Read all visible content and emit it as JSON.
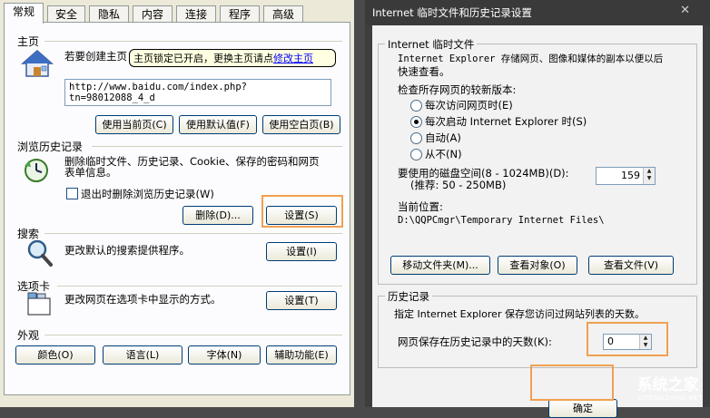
{
  "tabs": [
    "常规",
    "安全",
    "隐私",
    "内容",
    "连接",
    "程序",
    "高级"
  ],
  "home": {
    "title": "主页",
    "desc": "若要创建主页",
    "url": "http://www.baidu.com/index.php?tn=98012088_4_d",
    "tooltip_text": "主页锁定已开启，更换主页请点",
    "tooltip_link": "修改主页",
    "btn_current": "使用当前页(C)",
    "btn_default": "使用默认值(F)",
    "btn_blank": "使用空白页(B)"
  },
  "history": {
    "title": "浏览历史记录",
    "desc_line1": "删除临时文件、历史记录、Cookie、保存的密码和网页",
    "desc_line2": "表单信息。",
    "checkbox_label": "退出时删除浏览历史记录(W)",
    "btn_delete": "删除(D)...",
    "btn_settings": "设置(S)"
  },
  "search": {
    "title": "搜索",
    "desc": "更改默认的搜索提供程序。",
    "btn_settings": "设置(I)"
  },
  "tabs_section": {
    "title": "选项卡",
    "desc": "更改网页在选项卡中显示的方式。",
    "btn_settings": "设置(T)"
  },
  "appearance": {
    "title": "外观",
    "btn_colors": "颜色(O)",
    "btn_languages": "语言(L)",
    "btn_fonts": "字体(N)",
    "btn_accessibility": "辅助功能(E)"
  },
  "dialog": {
    "title": "Internet 临时文件和历史记录设置",
    "close_label": "✕",
    "temp_group": "Internet 临时文件",
    "temp_desc_line1": "Internet Explorer 存储网页、图像和媒体的副本以便以后",
    "temp_desc_line2": "快速查看。",
    "check_newer": "检查所存网页的较新版本:",
    "radios": [
      "每次访问网页时(E)",
      "每次启动 Internet Explorer 时(S)",
      "自动(A)",
      "从不(N)"
    ],
    "selected_radio": 1,
    "disk_label_line1": "要使用的磁盘空间(8 - 1024MB)(D):",
    "disk_label_line2": "(推荐: 50 - 250MB)",
    "disk_value": "159",
    "current_location_label": "当前位置:",
    "current_location": "D:\\QQPCmgr\\Temporary Internet Files\\",
    "btn_move": "移动文件夹(M)...",
    "btn_view_objects": "查看对象(O)",
    "btn_view_files": "查看文件(V)",
    "history_group": "历史记录",
    "history_desc": "指定 Internet Explorer 保存您访问过网站列表的天数。",
    "days_label": "网页保存在历史记录中的天数(K):",
    "days_value": "0",
    "btn_ok": "确定"
  },
  "watermark": {
    "text": "系统之家",
    "sub": "XITONGZHIJIA.NET"
  },
  "colors": {
    "highlight": "#f0a050",
    "dialog_dark": "#3e3e3e"
  }
}
